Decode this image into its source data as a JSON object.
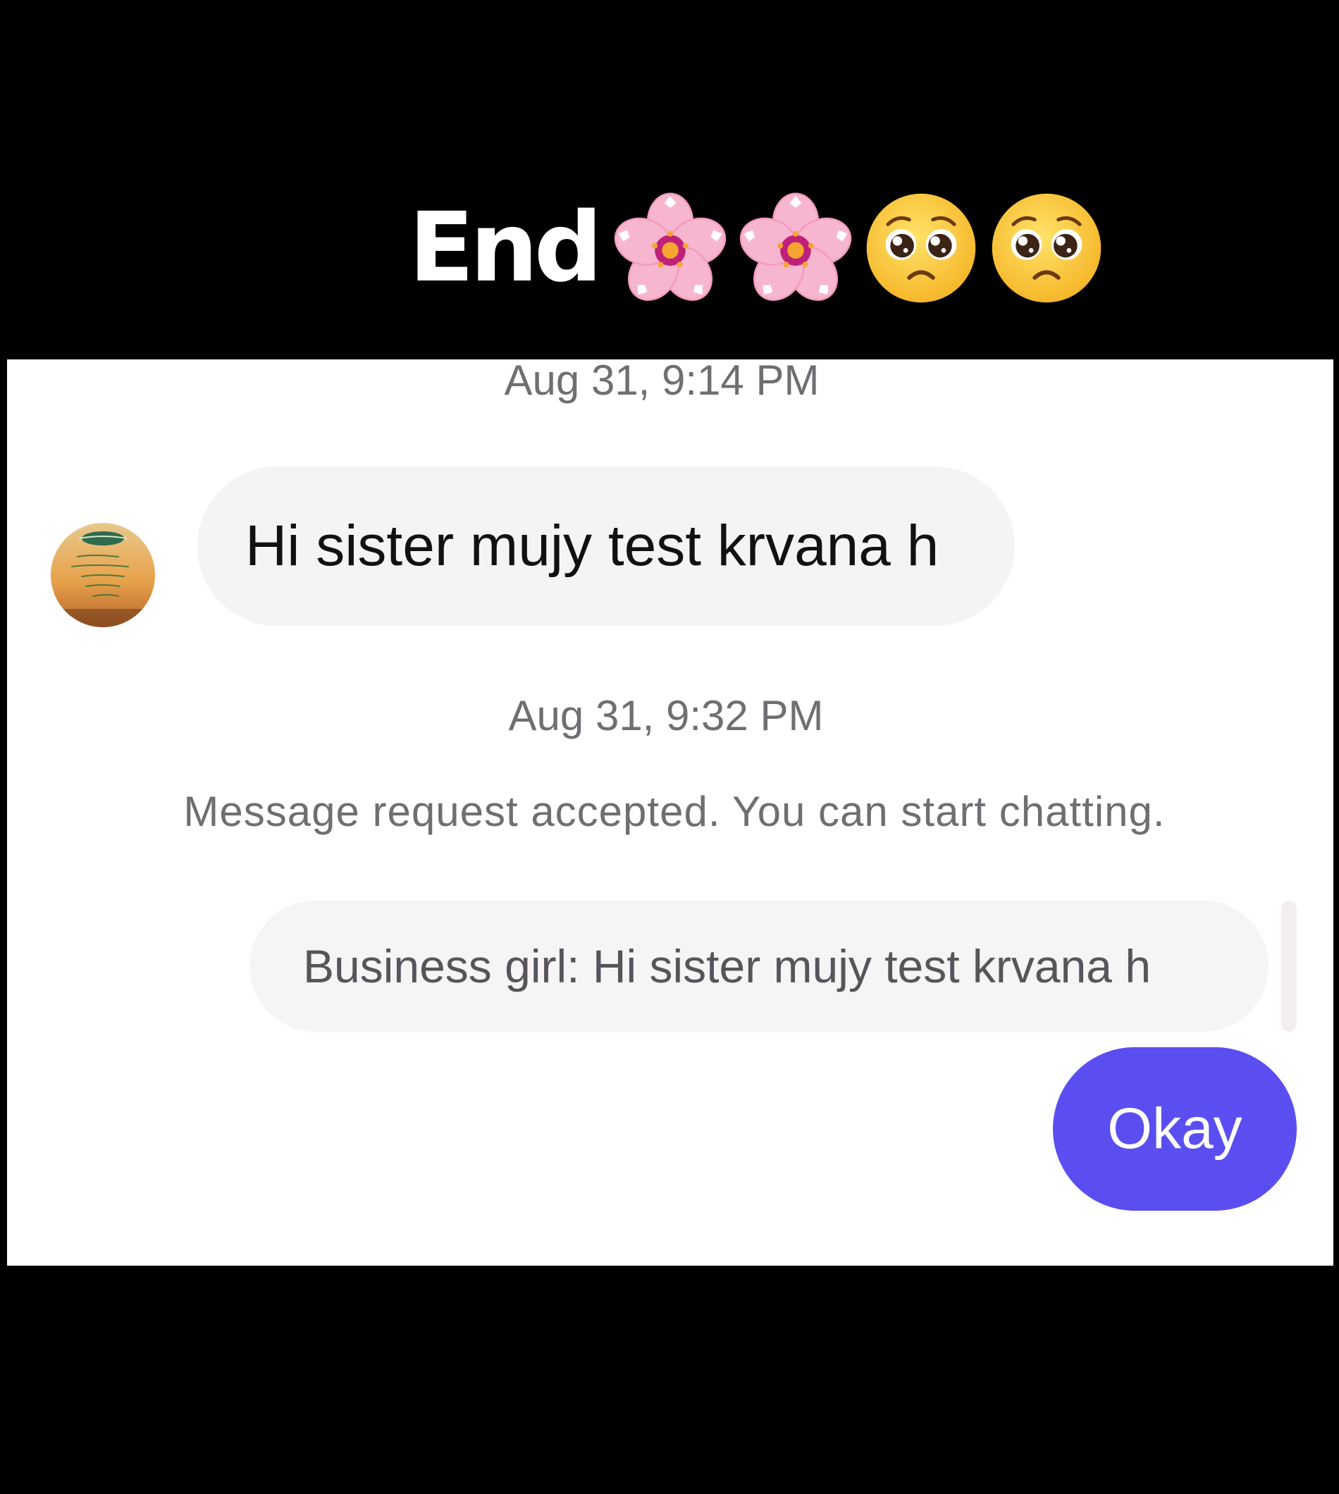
{
  "caption": {
    "text": "End",
    "emojis": [
      "cherry-blossom",
      "cherry-blossom",
      "pleading-face",
      "pleading-face"
    ]
  },
  "conversation": {
    "messages": [
      {
        "type": "timestamp",
        "text": "Aug 31, 9:14 PM"
      },
      {
        "type": "incoming",
        "text": "Hi sister mujy test krvana h"
      },
      {
        "type": "timestamp",
        "text": "Aug 31, 9:32 PM"
      },
      {
        "type": "system",
        "text": "Message request accepted. You can start chatting."
      },
      {
        "type": "reply-preview",
        "text": "Business girl: Hi sister mujy test krvana h"
      },
      {
        "type": "outgoing",
        "text": "Okay"
      }
    ]
  },
  "colors": {
    "outgoing_bubble": "#5b4ef0",
    "incoming_bubble": "#f4f4f6",
    "reply_preview": "#f7f4f6",
    "timestamp_text": "#6f6f73",
    "background": "#000000"
  }
}
